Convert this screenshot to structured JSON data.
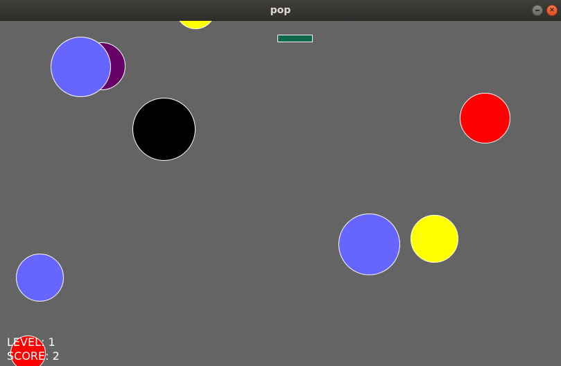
{
  "window": {
    "title": "pop"
  },
  "hud": {
    "level_text": "LEVEL: 1",
    "score_text": "SCORE: 2"
  },
  "colors": {
    "background": "#646464",
    "paddle": "#0f6b47",
    "bubble_outline": "#ffffff",
    "blue": "#6666ff",
    "purple": "#660066",
    "black": "#000000",
    "red": "#ff0000",
    "yellow": "#ffff00"
  },
  "bubbles": [
    {
      "id": "yellow-top",
      "color": "yellow"
    },
    {
      "id": "purple",
      "color": "purple"
    },
    {
      "id": "blue-1",
      "color": "blue"
    },
    {
      "id": "black",
      "color": "black"
    },
    {
      "id": "red-1",
      "color": "red"
    },
    {
      "id": "blue-2",
      "color": "blue"
    },
    {
      "id": "yellow-2",
      "color": "yellow"
    },
    {
      "id": "blue-3",
      "color": "blue"
    },
    {
      "id": "red-2",
      "color": "red"
    }
  ]
}
